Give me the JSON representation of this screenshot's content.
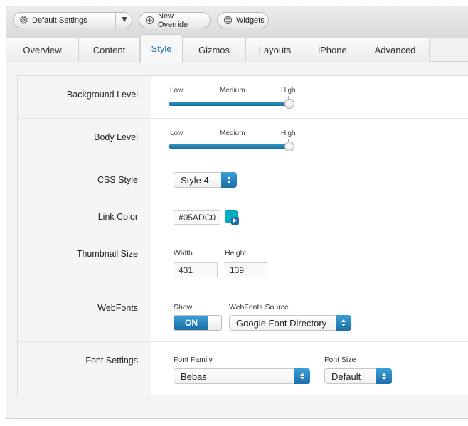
{
  "toolbar": {
    "settings_label": "Default Settings",
    "override_label": "New Override",
    "widgets_label": "Widgets"
  },
  "tabs": [
    {
      "label": "Overview"
    },
    {
      "label": "Content"
    },
    {
      "label": "Style",
      "active": true
    },
    {
      "label": "Gizmos"
    },
    {
      "label": "Layouts"
    },
    {
      "label": "iPhone"
    },
    {
      "label": "Advanced"
    }
  ],
  "rows": {
    "background_level": {
      "label": "Background Level",
      "ticks": [
        "Low",
        "Medium",
        "High"
      ],
      "value": "High"
    },
    "body_level": {
      "label": "Body Level",
      "ticks": [
        "Low",
        "Medium",
        "High"
      ],
      "value": "High"
    },
    "css_style": {
      "label": "CSS Style",
      "value": "Style 4"
    },
    "link_color": {
      "label": "Link Color",
      "value": "#05ADC0",
      "swatch_color": "#05adc0"
    },
    "thumbnail_size": {
      "label": "Thumbnail Size",
      "width_label": "Width",
      "width_value": "431",
      "height_label": "Height",
      "height_value": "139"
    },
    "webfonts": {
      "label": "WebFonts",
      "show_label": "Show",
      "toggle_value": "ON",
      "source_label": "WebFonts Source",
      "source_value": "Google Font Directory"
    },
    "font_settings": {
      "label": "Font Settings",
      "family_label": "Font Family",
      "family_value": "Bebas",
      "size_label": "Font Size",
      "size_value": "Default"
    }
  },
  "colors": {
    "accent": "#1d6fa8",
    "active_tab_text": "#1a6fa3",
    "link_color": "#05adc0"
  }
}
